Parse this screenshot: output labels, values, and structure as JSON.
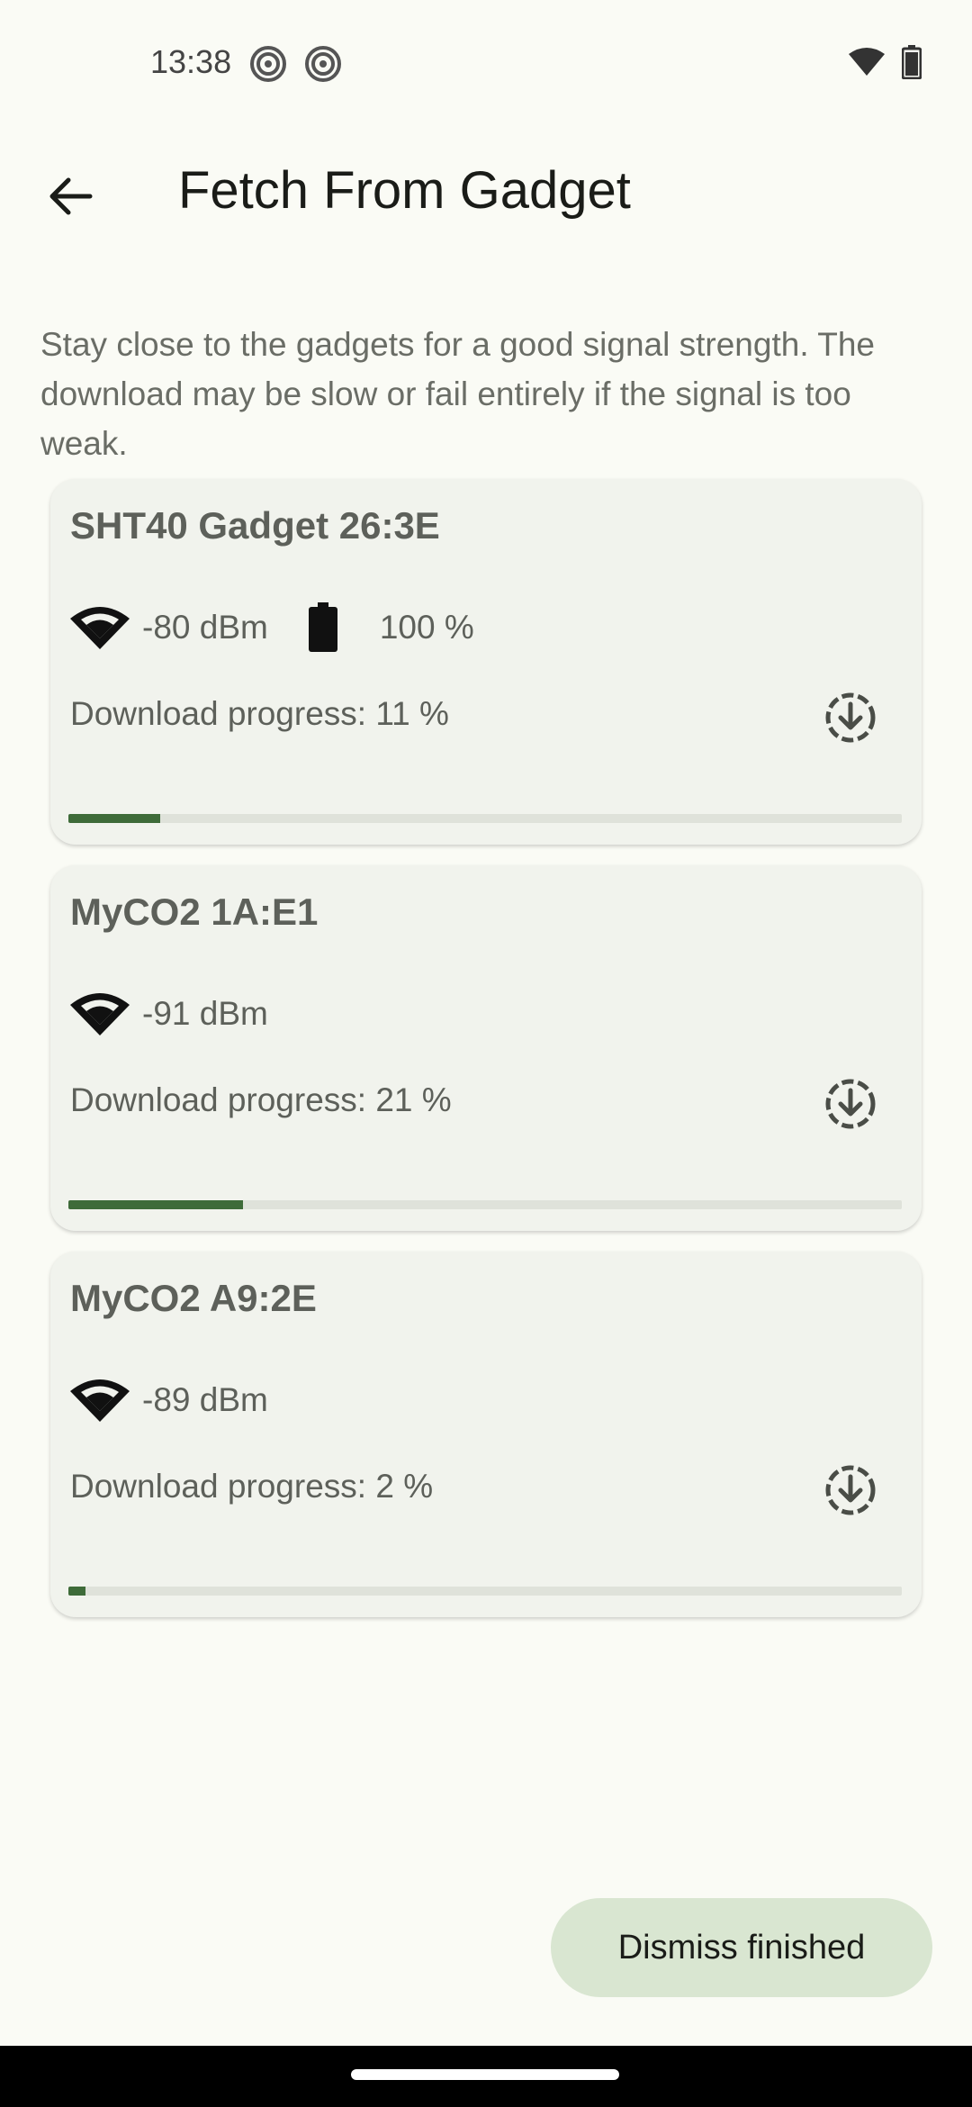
{
  "status_bar": {
    "time": "13:38",
    "icons": [
      "hotspot-icon",
      "hotspot-icon",
      "wifi-icon",
      "battery-icon"
    ]
  },
  "app_bar": {
    "back_icon": "arrow-left-icon",
    "title": "Fetch From Gadget"
  },
  "intro_text": "Stay close to the gadgets for a good signal strength. The download may be slow or fail entirely if the signal is too weak.",
  "gadgets": [
    {
      "name": "SHT40 Gadget 26:3E",
      "signal": "-80 dBm",
      "battery": "100 %",
      "progress_text": "Download progress: 11 %",
      "progress": 0.11
    },
    {
      "name": "MyCO2 1A:E1",
      "signal": "-91 dBm",
      "progress_text": "Download progress: 21 %",
      "progress": 0.21
    },
    {
      "name": "MyCO2 A9:2E",
      "signal": "-89 dBm",
      "progress_text": "Download progress: 2 %",
      "progress": 0.02
    }
  ],
  "dismiss_button": "Dismiss finished",
  "colors": {
    "background": "#fafbf5",
    "card": "#f1f3ed",
    "progress_fill": "#3e6b39",
    "progress_track": "#dfe2da",
    "fab": "#d9e6d1"
  }
}
